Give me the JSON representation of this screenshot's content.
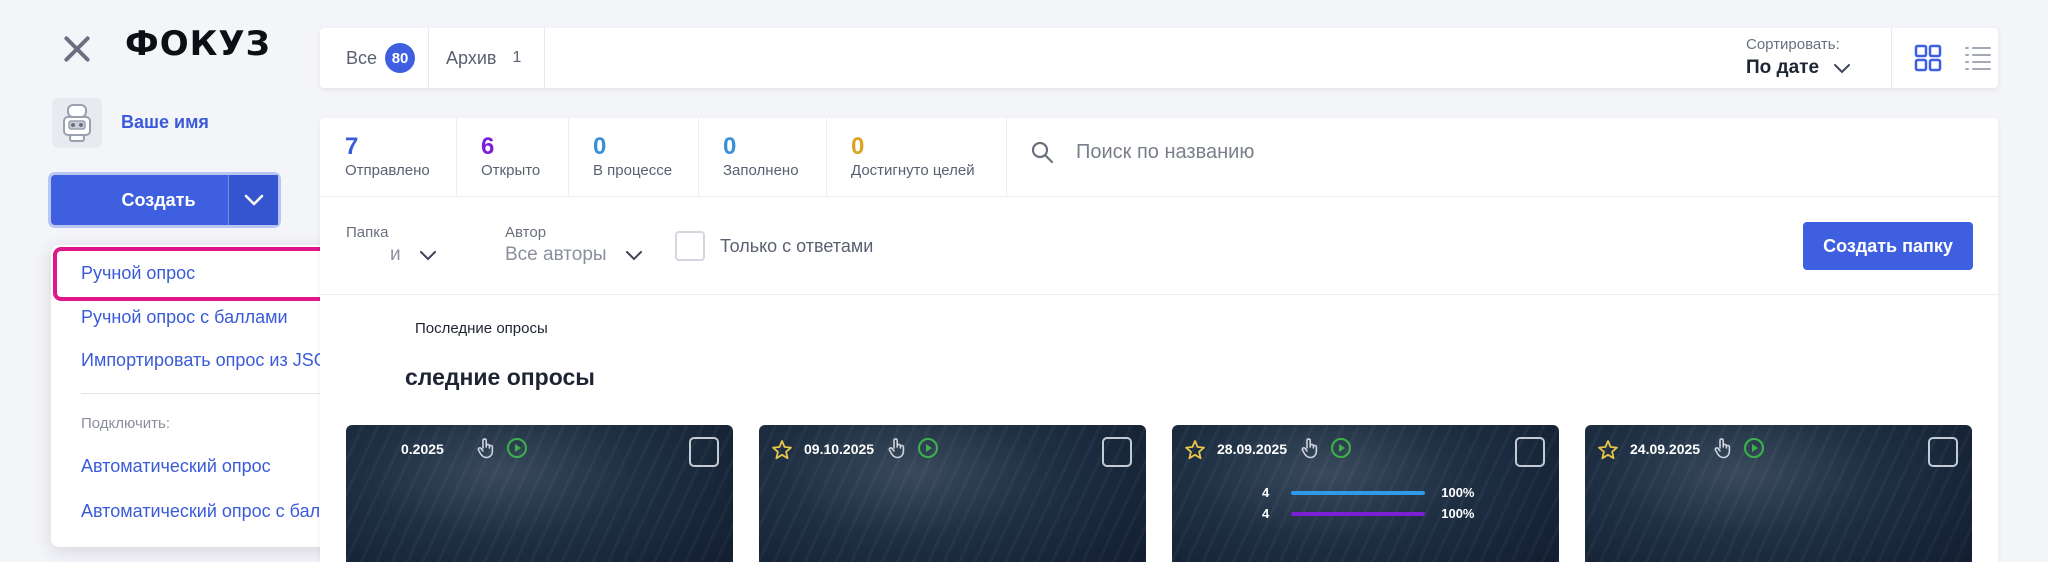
{
  "sidebar": {
    "logo": "ФОКУЗ",
    "user_name": "Ваше имя",
    "create_label": "Создать",
    "menu": {
      "items": [
        "Ручной опрос",
        "Ручной опрос с баллами",
        "Импортировать опрос из JSON-файла"
      ],
      "connect_label": "Подключить:",
      "connect_items": [
        "Автоматический опрос",
        "Автоматический опрос с баллами"
      ]
    }
  },
  "topbar": {
    "tabs": [
      {
        "label": "Все",
        "count": "80"
      },
      {
        "label": "Архив",
        "count": "1"
      }
    ],
    "sort_label": "Сортировать:",
    "sort_value": "По дате"
  },
  "stats": [
    {
      "value": "7",
      "label": "Отправлено",
      "color": "#3a5bd9"
    },
    {
      "value": "6",
      "label": "Открыто",
      "color": "#7a1fd6"
    },
    {
      "value": "0",
      "label": "В процессе",
      "color": "#3a8fd9"
    },
    {
      "value": "0",
      "label": "Заполнено",
      "color": "#3a8fd9"
    },
    {
      "value": "0",
      "label": "Достигнуто целей",
      "color": "#d9a520"
    }
  ],
  "search": {
    "placeholder": "Поиск по названию"
  },
  "filters": {
    "folder_label": "Папка",
    "folder_value": "и",
    "author_label": "Автор",
    "author_value": "Все авторы",
    "only_answers": "Только с ответами",
    "create_folder": "Создать папку"
  },
  "breadcrumb": "Последние опросы",
  "section_title": "следние опросы",
  "cards": [
    {
      "date": "0.2025",
      "starred": false,
      "bars": []
    },
    {
      "date": "09.10.2025",
      "starred": true,
      "bars": []
    },
    {
      "date": "28.09.2025",
      "starred": true,
      "bars": [
        {
          "count": "4",
          "percent": "100%",
          "fraction": 1.0,
          "color": "#2d9be8"
        },
        {
          "count": "4",
          "percent": "100%",
          "fraction": 1.0,
          "color": "#7a1fd6"
        }
      ]
    },
    {
      "date": "24.09.2025",
      "starred": true,
      "bars": []
    }
  ],
  "colors": {
    "accent": "#3d5fe0",
    "highlight": "#e0178a",
    "star": "#e8c547",
    "play": "#3bb34a"
  }
}
